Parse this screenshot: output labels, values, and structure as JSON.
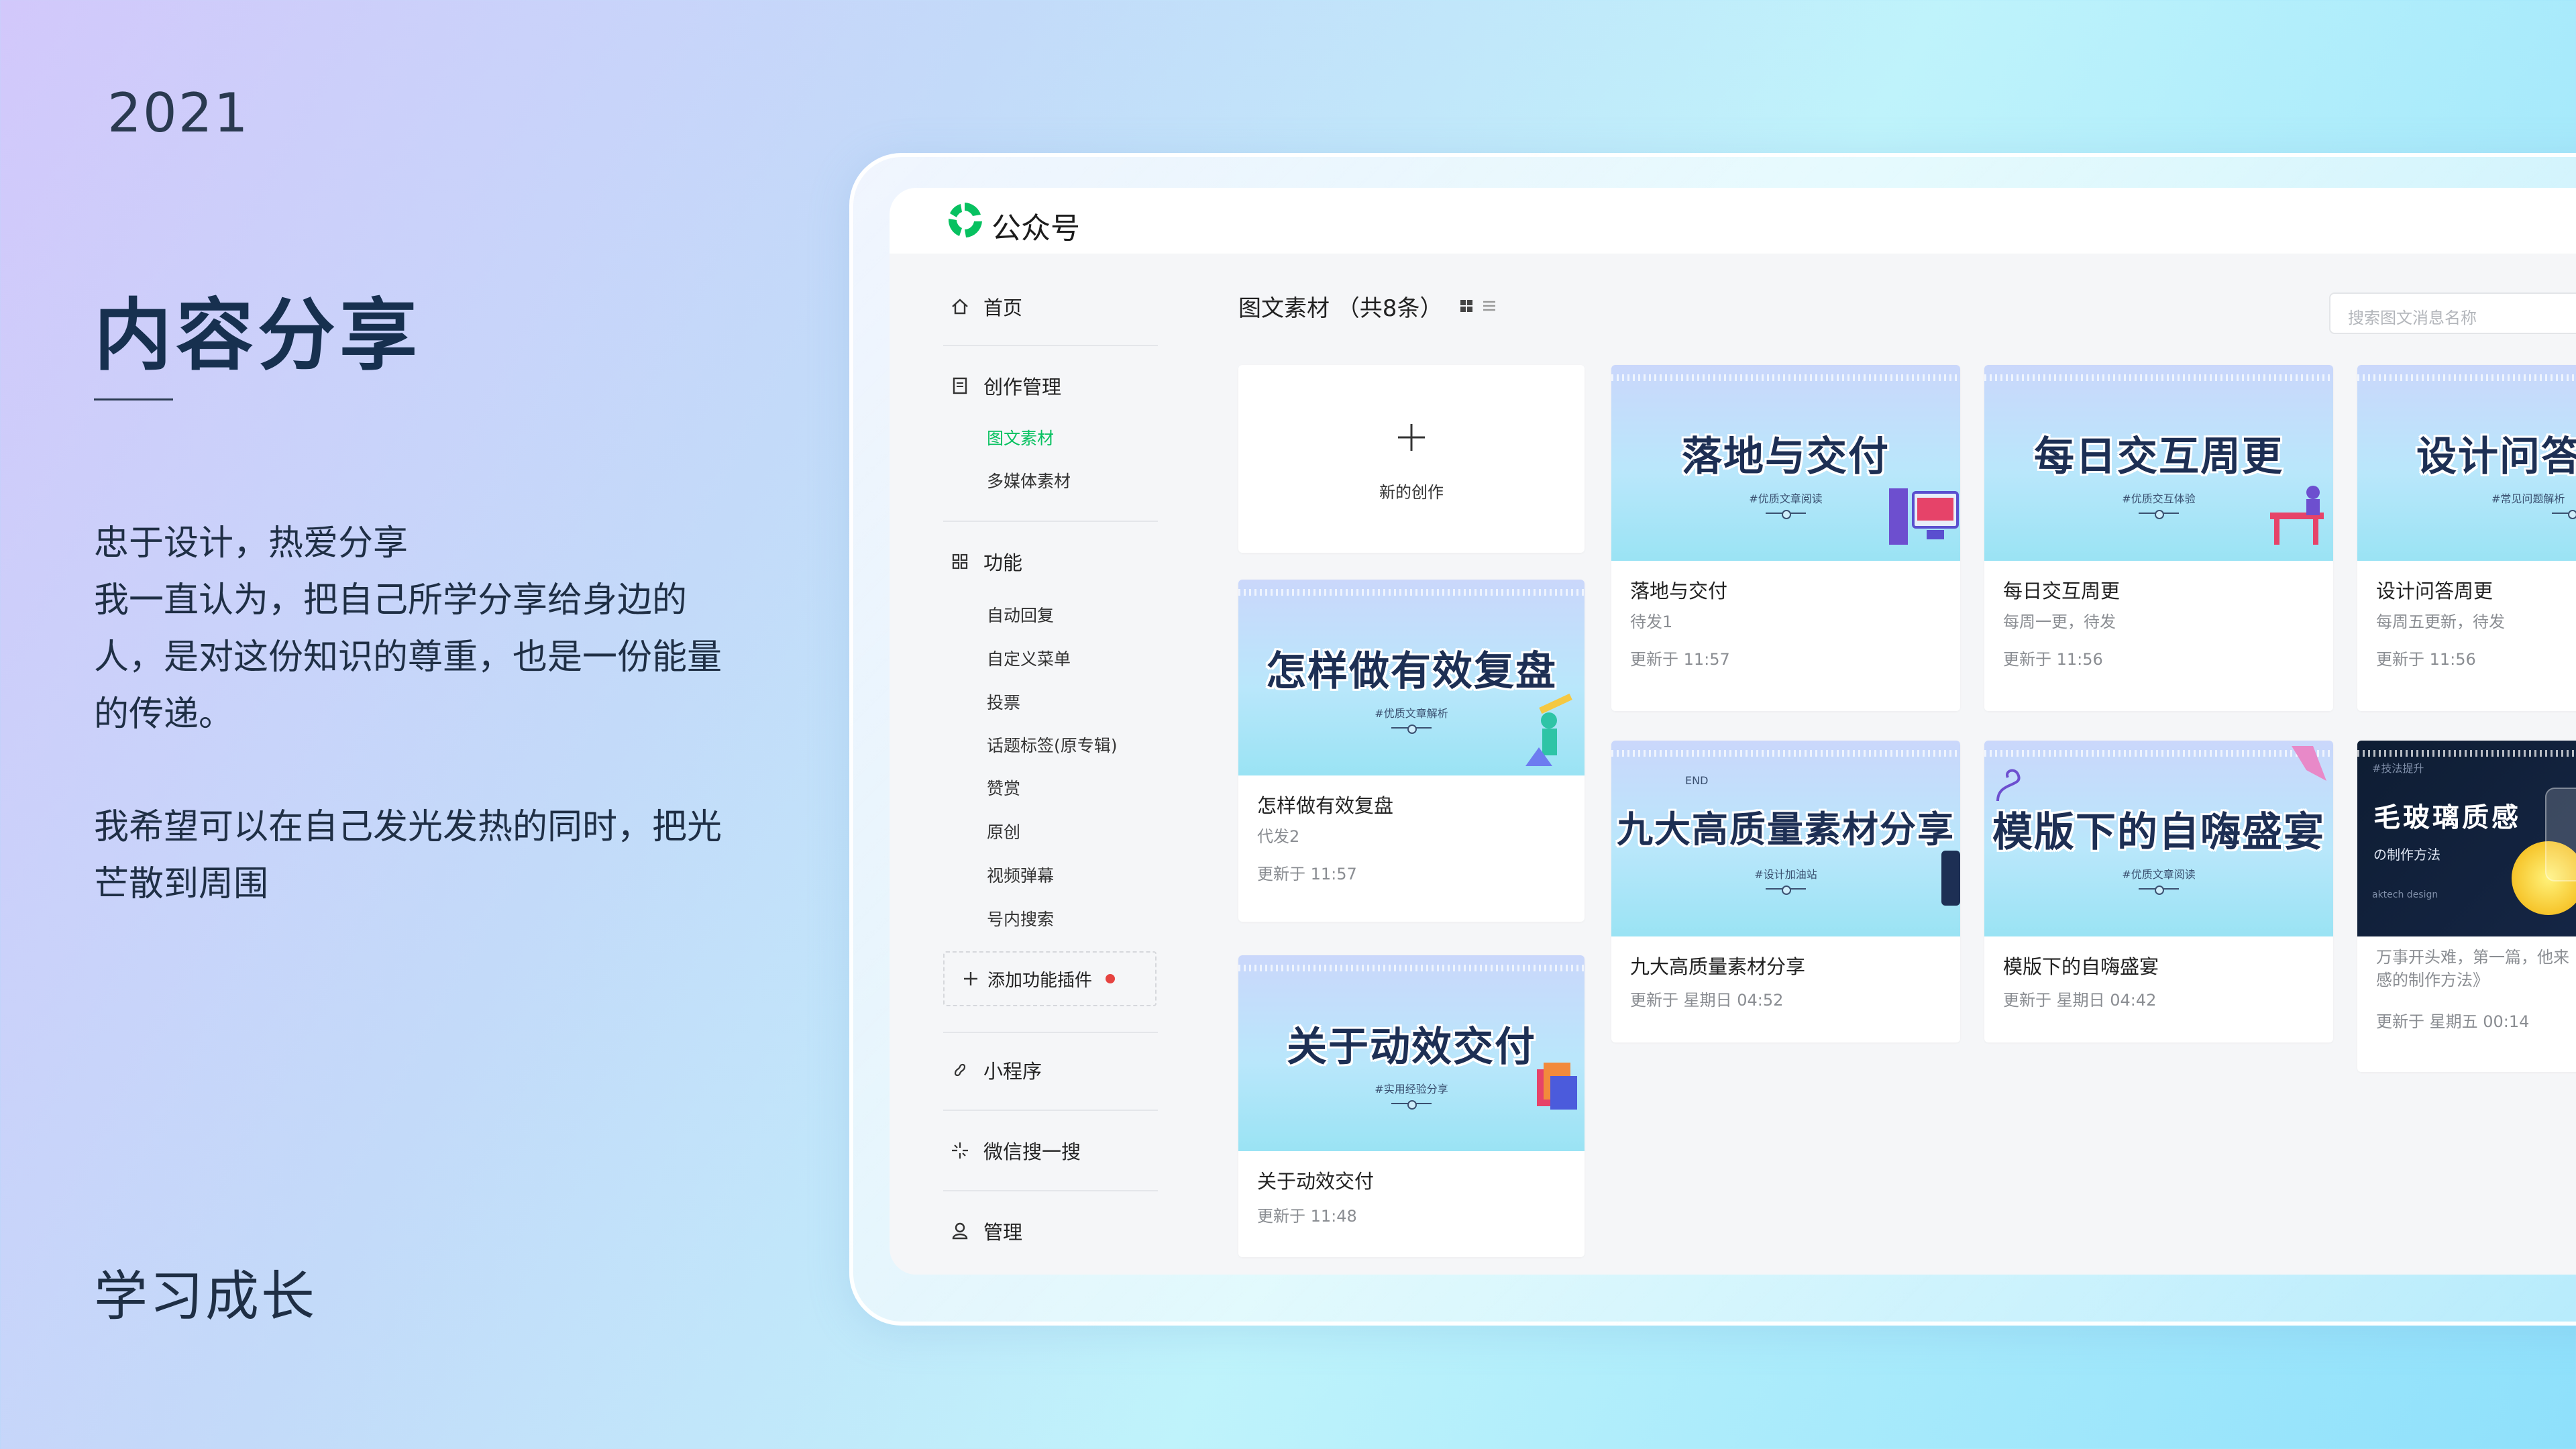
{
  "year": "2021",
  "title": "内容分享",
  "intro": {
    "lines": [
      "忠于设计，热爱分享",
      "我一直认为，把自己所学分享给身边的",
      "人，是对这份知识的尊重，也是一份能量",
      "的传递。"
    ],
    "lines2": [
      "我希望可以在自己发光发热的同时，把光",
      "芒散到周围"
    ]
  },
  "footer": "学习成长",
  "app": {
    "name": "公众号",
    "brand_color": "#07c160"
  },
  "sidebar": {
    "home": "首页",
    "creation": "创作管理",
    "creation_items": [
      "图文素材",
      "多媒体素材"
    ],
    "features": "功能",
    "feature_items": [
      "自动回复",
      "自定义菜单",
      "投票",
      "话题标签(原专辑)",
      "赞赏",
      "原创",
      "视频弹幕",
      "号内搜索"
    ],
    "add_plugin": "添加功能插件",
    "mini_program": "小程序",
    "wechat_search": "微信搜一搜",
    "manage": "管理"
  },
  "main": {
    "title": "图文素材 （共8条）",
    "search_placeholder": "搜索图文消息名称",
    "new_card": "新的创作"
  },
  "cards": [
    {
      "cover_title": "怎样做有效复盘",
      "cover_tag": "#优质文章解析",
      "title": "怎样做有效复盘",
      "status": "代发2",
      "updated": "更新于 11:57"
    },
    {
      "cover_title": "关于动效交付",
      "cover_tag": "#实用经验分享",
      "title": "关于动效交付",
      "updated": "更新于 11:48"
    },
    {
      "cover_title": "落地与交付",
      "cover_tag": "#优质文章阅读",
      "title": "落地与交付",
      "status": "待发1",
      "updated": "更新于 11:57"
    },
    {
      "cover_title": "九大高质量素材分享",
      "cover_tag": "#设计加油站",
      "cover_small": "END",
      "title": "九大高质量素材分享",
      "updated": "更新于 星期日 04:52"
    },
    {
      "cover_title": "每日交互周更",
      "cover_tag": "#优质交互体验",
      "title": "每日交互周更",
      "status": "每周一更，待发",
      "updated": "更新于 11:56"
    },
    {
      "cover_title": "模版下的自嗨盛宴",
      "cover_tag": "#优质文章阅读",
      "title": "模版下的自嗨盛宴",
      "updated": "更新于 星期日 04:42"
    },
    {
      "cover_title": "设计问答",
      "cover_tag": "#常见问题解析",
      "title": "设计问答周更",
      "status": "每周五更新，待发",
      "updated": "更新于 11:56"
    },
    {
      "cover_title": "毛玻璃质感",
      "cover_small": "#技法提升",
      "cover_sub": "の制作方法",
      "cover_foot": "aktech design",
      "title": "",
      "desc": [
        "万事开头难，第一篇，他来",
        "感的制作方法》"
      ],
      "updated": "更新于 星期五 00:14"
    }
  ]
}
